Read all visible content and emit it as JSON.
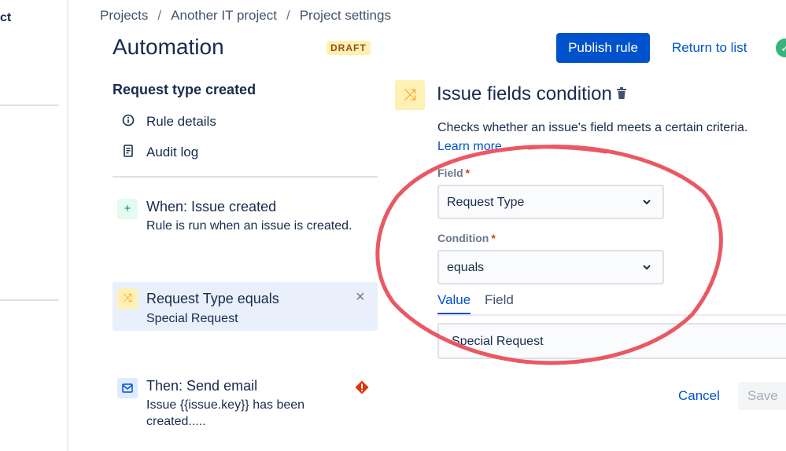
{
  "sidebar": {
    "fragment": "ct"
  },
  "breadcrumb": {
    "items": [
      "Projects",
      "Another IT project",
      "Project settings"
    ]
  },
  "header": {
    "title": "Automation",
    "badge": "DRAFT",
    "publish_label": "Publish rule",
    "return_label": "Return to list"
  },
  "rule": {
    "name": "Request type created",
    "nav": [
      {
        "label": "Rule details",
        "icon": "info-icon"
      },
      {
        "label": "Audit log",
        "icon": "document-icon"
      }
    ],
    "components": [
      {
        "title": "When: Issue created",
        "subtitle": "Rule is run when an issue is created.",
        "icon": "plus-icon"
      },
      {
        "title": "Request Type equals",
        "subtitle": "Special Request",
        "icon": "shuffle-icon"
      },
      {
        "title": "Then: Send email",
        "subtitle": "Issue {{issue.key}} has been created.....",
        "icon": "mail-icon"
      }
    ]
  },
  "panel": {
    "title": "Issue fields condition",
    "description": "Checks whether an issue's field meets a certain criteria.",
    "learn_more": "Learn more.",
    "field_label": "Field",
    "field_value": "Request Type",
    "condition_label": "Condition",
    "condition_value": "equals",
    "tabs": [
      "Value",
      "Field"
    ],
    "value_text": "Special Request",
    "cancel_label": "Cancel",
    "save_label": "Save"
  },
  "colors": {
    "accent": "#0052cc",
    "annotation": "#e8505b",
    "badge_bg": "#fff0b3",
    "error": "#de350b"
  }
}
